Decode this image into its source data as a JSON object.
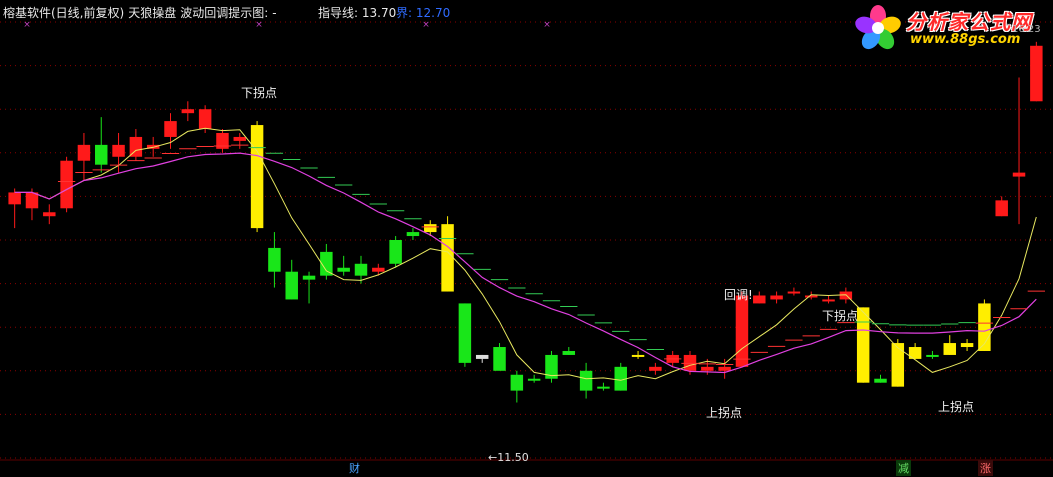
{
  "header": {
    "software": "榕基软件(日线,前复权)",
    "indicator": "天狼操盘",
    "subtitle": "波动回调提示图:",
    "dash": "-",
    "guide_label": "指导线: 13.70",
    "bound_label": "界: 12.70"
  },
  "logo": {
    "name": "分析家公式网",
    "url": "www.88gs.com",
    "corner": "16.23"
  },
  "annotations": [
    {
      "text": "下拐点",
      "id": "ann-down-1"
    },
    {
      "text": "回调!",
      "id": "ann-pullback"
    },
    {
      "text": "下拐点",
      "id": "ann-down-2"
    },
    {
      "text": "上拐点",
      "id": "ann-up-1"
    },
    {
      "text": "上拐点",
      "id": "ann-up-2"
    }
  ],
  "low_label": "←11.50",
  "bottom_markers": [
    {
      "text": "财",
      "color": "#4aa3ff"
    },
    {
      "text": "减",
      "color": "#66dd66"
    },
    {
      "text": "涨",
      "color": "#ff6b6b"
    }
  ],
  "colors": {
    "up": "#ff1a1a",
    "down": "#19e619",
    "signal": "#ffee00",
    "ma_fast": "#e8e860",
    "ma_slow": "#e040e0",
    "grid": "#8b0000",
    "purple_x": "#c040c0"
  },
  "chart_data": {
    "type": "candlestick",
    "ylim": [
      11.0,
      16.5
    ],
    "candles": [
      {
        "o": 14.2,
        "h": 14.4,
        "l": 13.9,
        "c": 14.35,
        "k": "up"
      },
      {
        "o": 14.15,
        "h": 14.4,
        "l": 14.0,
        "c": 14.35,
        "k": "up"
      },
      {
        "o": 14.05,
        "h": 14.2,
        "l": 13.95,
        "c": 14.1,
        "k": "up"
      },
      {
        "o": 14.15,
        "h": 14.8,
        "l": 14.1,
        "c": 14.75,
        "k": "up"
      },
      {
        "o": 14.75,
        "h": 15.1,
        "l": 14.5,
        "c": 14.95,
        "k": "up"
      },
      {
        "o": 14.95,
        "h": 15.3,
        "l": 14.6,
        "c": 14.7,
        "k": "down"
      },
      {
        "o": 14.8,
        "h": 15.1,
        "l": 14.6,
        "c": 14.95,
        "k": "up"
      },
      {
        "o": 14.8,
        "h": 15.15,
        "l": 14.75,
        "c": 15.05,
        "k": "up"
      },
      {
        "o": 14.9,
        "h": 15.05,
        "l": 14.8,
        "c": 14.95,
        "k": "up"
      },
      {
        "o": 15.05,
        "h": 15.35,
        "l": 14.9,
        "c": 15.25,
        "k": "up"
      },
      {
        "o": 15.35,
        "h": 15.5,
        "l": 15.25,
        "c": 15.4,
        "k": "up"
      },
      {
        "o": 15.4,
        "h": 15.45,
        "l": 15.1,
        "c": 15.15,
        "k": "up"
      },
      {
        "o": 15.1,
        "h": 15.15,
        "l": 14.85,
        "c": 14.9,
        "k": "up"
      },
      {
        "o": 15.05,
        "h": 15.1,
        "l": 14.9,
        "c": 15.0,
        "k": "up"
      },
      {
        "o": 15.2,
        "h": 15.25,
        "l": 13.85,
        "c": 13.9,
        "k": "signal"
      },
      {
        "o": 13.65,
        "h": 13.85,
        "l": 13.15,
        "c": 13.35,
        "k": "down"
      },
      {
        "o": 13.35,
        "h": 13.5,
        "l": 13.0,
        "c": 13.0,
        "k": "down"
      },
      {
        "o": 13.3,
        "h": 13.35,
        "l": 12.95,
        "c": 13.25,
        "k": "down"
      },
      {
        "o": 13.6,
        "h": 13.7,
        "l": 13.25,
        "c": 13.3,
        "k": "down"
      },
      {
        "o": 13.4,
        "h": 13.55,
        "l": 13.3,
        "c": 13.35,
        "k": "down"
      },
      {
        "o": 13.45,
        "h": 13.55,
        "l": 13.2,
        "c": 13.3,
        "k": "down"
      },
      {
        "o": 13.4,
        "h": 13.45,
        "l": 13.3,
        "c": 13.35,
        "k": "up"
      },
      {
        "o": 13.45,
        "h": 13.8,
        "l": 13.4,
        "c": 13.75,
        "k": "down"
      },
      {
        "o": 13.8,
        "h": 13.9,
        "l": 13.75,
        "c": 13.85,
        "k": "down"
      },
      {
        "o": 13.85,
        "h": 14.0,
        "l": 13.8,
        "c": 13.95,
        "k": "signal"
      },
      {
        "o": 13.95,
        "h": 14.05,
        "l": 13.1,
        "c": 13.1,
        "k": "signal"
      },
      {
        "o": 12.95,
        "h": 12.95,
        "l": 12.15,
        "c": 12.2,
        "k": "down"
      },
      {
        "o": 12.3,
        "h": 12.3,
        "l": 12.2,
        "c": 12.25,
        "k": "flat"
      },
      {
        "o": 12.4,
        "h": 12.45,
        "l": 12.15,
        "c": 12.1,
        "k": "down"
      },
      {
        "o": 12.05,
        "h": 12.1,
        "l": 11.7,
        "c": 11.85,
        "k": "down"
      },
      {
        "o": 12.0,
        "h": 12.05,
        "l": 11.95,
        "c": 12.0,
        "k": "down"
      },
      {
        "o": 12.3,
        "h": 12.35,
        "l": 11.95,
        "c": 12.0,
        "k": "down"
      },
      {
        "o": 12.35,
        "h": 12.4,
        "l": 12.3,
        "c": 12.3,
        "k": "down"
      },
      {
        "o": 12.1,
        "h": 12.2,
        "l": 11.75,
        "c": 11.85,
        "k": "down"
      },
      {
        "o": 11.9,
        "h": 11.95,
        "l": 11.85,
        "c": 11.9,
        "k": "down"
      },
      {
        "o": 12.15,
        "h": 12.2,
        "l": 11.85,
        "c": 11.85,
        "k": "down"
      },
      {
        "o": 12.3,
        "h": 12.35,
        "l": 12.25,
        "c": 12.3,
        "k": "signal"
      },
      {
        "o": 12.15,
        "h": 12.2,
        "l": 12.05,
        "c": 12.1,
        "k": "up"
      },
      {
        "o": 12.2,
        "h": 12.35,
        "l": 12.15,
        "c": 12.3,
        "k": "up"
      },
      {
        "o": 12.1,
        "h": 12.35,
        "l": 12.05,
        "c": 12.3,
        "k": "up"
      },
      {
        "o": 12.15,
        "h": 12.25,
        "l": 12.05,
        "c": 12.1,
        "k": "up"
      },
      {
        "o": 12.1,
        "h": 12.25,
        "l": 12.0,
        "c": 12.15,
        "k": "up"
      },
      {
        "o": 12.15,
        "h": 13.1,
        "l": 12.15,
        "c": 13.05,
        "k": "up"
      },
      {
        "o": 12.95,
        "h": 13.1,
        "l": 12.95,
        "c": 13.05,
        "k": "up"
      },
      {
        "o": 13.0,
        "h": 13.1,
        "l": 12.95,
        "c": 13.05,
        "k": "up"
      },
      {
        "o": 13.1,
        "h": 13.15,
        "l": 13.05,
        "c": 13.1,
        "k": "up"
      },
      {
        "o": 13.05,
        "h": 13.1,
        "l": 13.0,
        "c": 13.05,
        "k": "up"
      },
      {
        "o": 13.0,
        "h": 13.05,
        "l": 12.95,
        "c": 13.0,
        "k": "up"
      },
      {
        "o": 13.0,
        "h": 13.15,
        "l": 12.95,
        "c": 13.1,
        "k": "up"
      },
      {
        "o": 12.9,
        "h": 12.9,
        "l": 11.95,
        "c": 11.95,
        "k": "signal"
      },
      {
        "o": 11.95,
        "h": 12.05,
        "l": 11.95,
        "c": 12.0,
        "k": "down"
      },
      {
        "o": 12.45,
        "h": 12.5,
        "l": 11.9,
        "c": 11.9,
        "k": "signal"
      },
      {
        "o": 12.4,
        "h": 12.45,
        "l": 12.25,
        "c": 12.25,
        "k": "signal"
      },
      {
        "o": 12.3,
        "h": 12.35,
        "l": 12.25,
        "c": 12.3,
        "k": "down"
      },
      {
        "o": 12.45,
        "h": 12.55,
        "l": 12.3,
        "c": 12.3,
        "k": "signal"
      },
      {
        "o": 12.45,
        "h": 12.5,
        "l": 12.35,
        "c": 12.4,
        "k": "signal"
      },
      {
        "o": 12.35,
        "h": 13.0,
        "l": 12.35,
        "c": 12.95,
        "k": "signal"
      },
      {
        "o": 14.25,
        "h": 14.3,
        "l": 14.05,
        "c": 14.05,
        "k": "up"
      },
      {
        "o": 14.55,
        "h": 15.8,
        "l": 13.95,
        "c": 14.6,
        "k": "up"
      },
      {
        "o": 15.5,
        "h": 16.25,
        "l": 15.5,
        "c": 16.2,
        "k": "up"
      }
    ]
  }
}
